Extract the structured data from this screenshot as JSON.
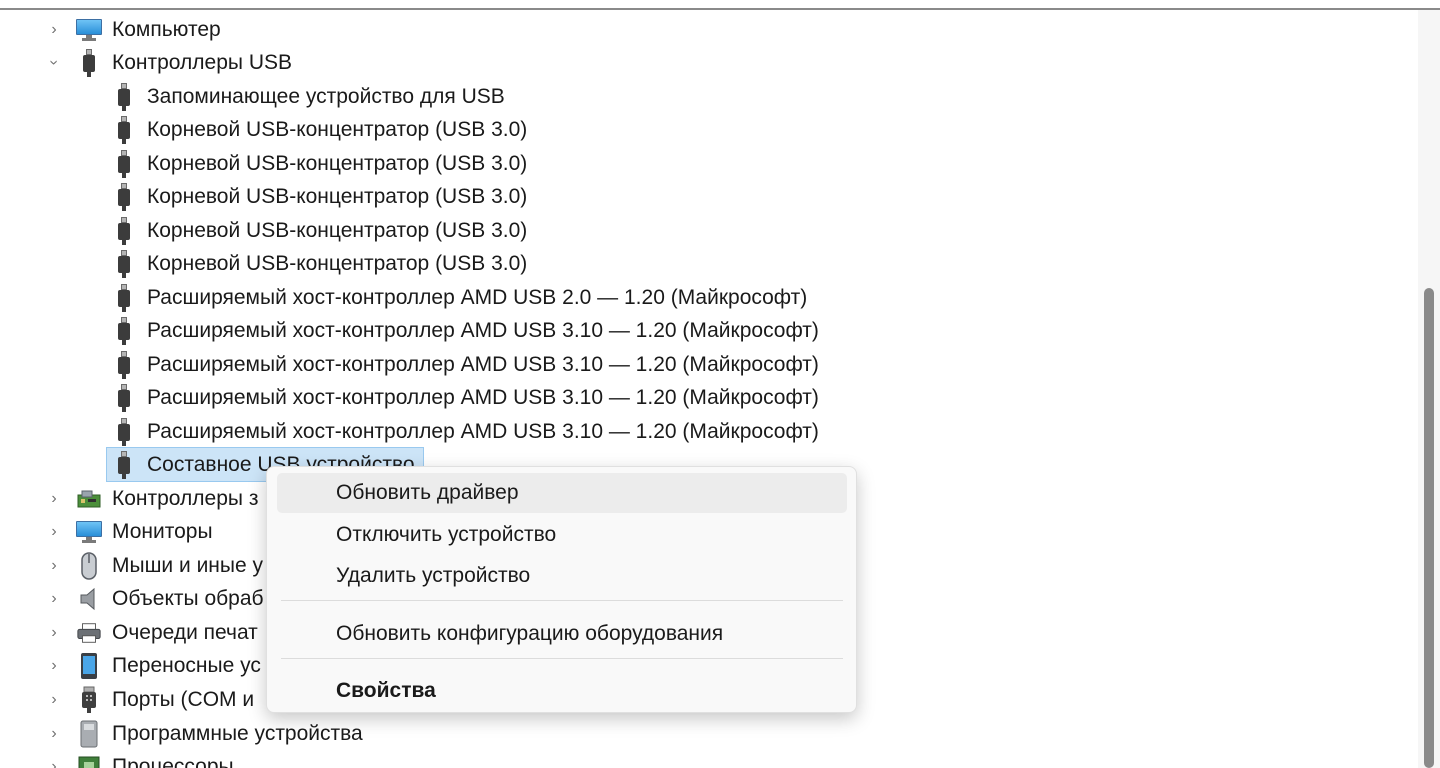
{
  "tree": {
    "computer": {
      "label": "Компьютер"
    },
    "usb_controllers": {
      "label": "Контроллеры USB",
      "children": [
        "Запоминающее устройство для USB",
        "Корневой USB-концентратор (USB 3.0)",
        "Корневой USB-концентратор (USB 3.0)",
        "Корневой USB-концентратор (USB 3.0)",
        "Корневой USB-концентратор (USB 3.0)",
        "Корневой USB-концентратор (USB 3.0)",
        "Расширяемый хост-контроллер AMD USB 2.0 — 1.20 (Майкрософт)",
        "Расширяемый хост-контроллер AMD USB 3.10 — 1.20 (Майкрософт)",
        "Расширяемый хост-контроллер AMD USB 3.10 — 1.20 (Майкрософт)",
        "Расширяемый хост-контроллер AMD USB 3.10 — 1.20 (Майкрософт)",
        "Расширяемый хост-контроллер AMD USB 3.10 — 1.20 (Майкрософт)"
      ],
      "selected": "Составное USB устройство"
    },
    "after": [
      {
        "label": "Контроллеры з",
        "icon": "storage-controller-icon"
      },
      {
        "label": "Мониторы",
        "icon": "monitor-icon"
      },
      {
        "label": "Мыши и иные у",
        "icon": "mouse-icon"
      },
      {
        "label": "Объекты обраб",
        "icon": "speaker-icon"
      },
      {
        "label": "Очереди печат",
        "icon": "printer-icon"
      },
      {
        "label": "Переносные ус",
        "icon": "portable-device-icon"
      },
      {
        "label": "Порты (COM и",
        "icon": "port-icon"
      },
      {
        "label": "Программные устройства",
        "icon": "software-device-icon"
      },
      {
        "label": "Процессоры",
        "icon": "processor-icon"
      }
    ]
  },
  "context_menu": {
    "items": [
      "Обновить драйвер",
      "Отключить устройство",
      "Удалить устройство"
    ],
    "rescan": "Обновить конфигурацию оборудования",
    "properties": "Свойства"
  },
  "colors": {
    "selection_bg": "#cce4f7",
    "selection_border": "#99c9ef",
    "menu_bg": "#f9f9f9",
    "scroll_thumb": "#8a8a8a"
  }
}
